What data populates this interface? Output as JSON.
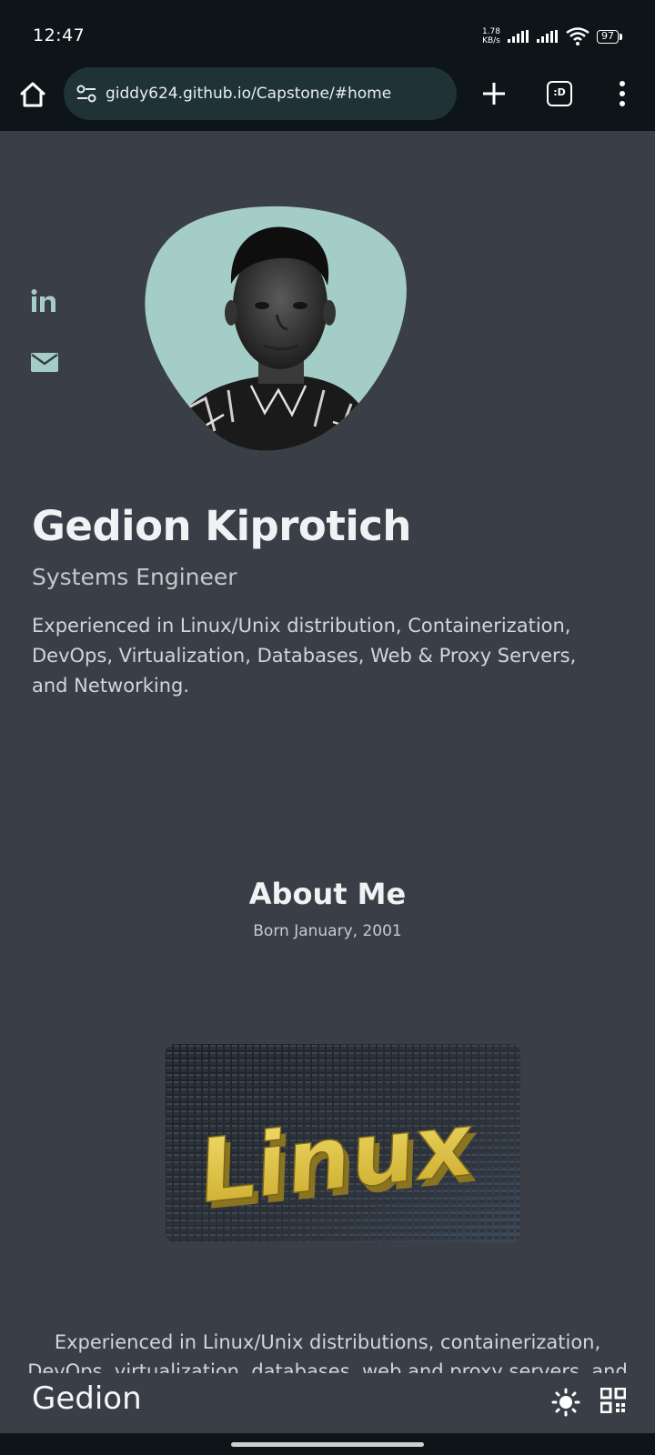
{
  "status_bar": {
    "time": "12:47",
    "net_speed_value": "1.78",
    "net_speed_unit": "KB/s",
    "battery": "97"
  },
  "browser": {
    "url": "giddy624.github.io/Capstone/#home",
    "tabs_label": ":D"
  },
  "hero": {
    "name": "Gedion Kiprotich",
    "role": "Systems Engineer",
    "intro": "Experienced in Linux/Unix distribution, Containerization, DevOps, Virtualization, Databases, Web & Proxy Servers, and Networking."
  },
  "about": {
    "title": "About Me",
    "subtitle": "Born January, 2001",
    "image_text": "Linux",
    "body": "Experienced in Linux/Unix distributions, containerization, DevOps, virtualization, databases, web and proxy servers, and"
  },
  "app_bar": {
    "brand": "Gedion"
  },
  "colors": {
    "page_bg": "#3a3e46",
    "accent": "#a5cdc7",
    "chrome": "#0d1518",
    "url_bar": "#1f3236"
  },
  "icons": [
    "home-icon",
    "site-settings-icon",
    "plus-icon",
    "tabs-icon",
    "menu-icon",
    "linkedin-icon",
    "mail-icon",
    "theme-icon",
    "qr-icon"
  ]
}
